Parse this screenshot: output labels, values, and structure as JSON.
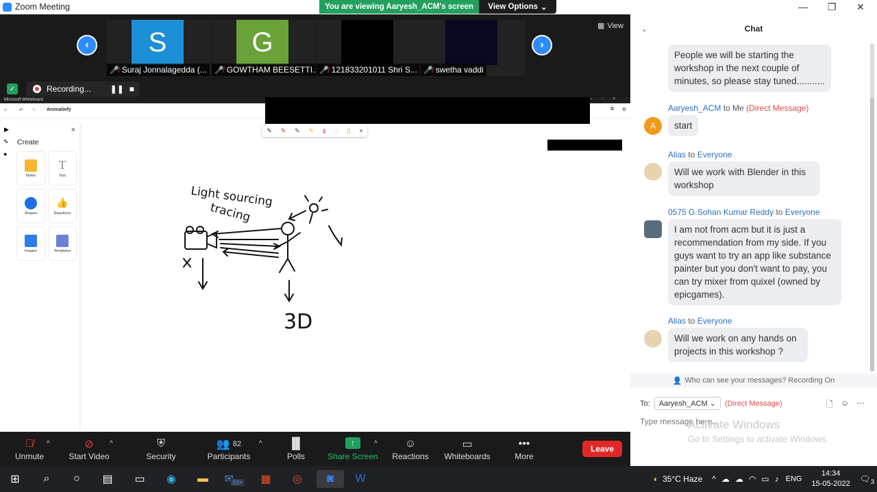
{
  "window": {
    "title": "Zoom Meeting",
    "banner": "You are viewing Aaryesh_ACM's screen",
    "view_options": "View Options",
    "view_button": "View"
  },
  "participants": [
    {
      "name": "Suraj Jonnalagedda (...",
      "initial": "S",
      "color": "#1d8fd6"
    },
    {
      "name": "GOWTHAM BEESETTI...",
      "initial": "G",
      "color": "#6aa23a"
    },
    {
      "name": "121833201011 Shri S...",
      "initial": "",
      "color": "#000000"
    },
    {
      "name": "swetha vaddi",
      "initial": "",
      "color": "#080820"
    }
  ],
  "recording": {
    "label": "Recording..."
  },
  "whiteboard": {
    "app_title": "Microsoft Whiteboard",
    "board_name": "Animatiefy",
    "panel_title": "Create",
    "items": [
      {
        "label": "Notes",
        "icon": "notes-icon"
      },
      {
        "label": "Text",
        "icon": "text-icon"
      },
      {
        "label": "Shapes",
        "icon": "shapes-icon"
      },
      {
        "label": "Reactions",
        "icon": "reactions-icon"
      },
      {
        "label": "Images",
        "icon": "images-icon"
      },
      {
        "label": "Templates",
        "icon": "templates-icon"
      }
    ],
    "drawing_text": {
      "line1": "Light sourcing",
      "line2": "tracing",
      "mark": "X",
      "label3d": "3D"
    }
  },
  "toolbar": {
    "unmute": "Unmute",
    "start_video": "Start Video",
    "security": "Security",
    "participants": "Participants",
    "participant_count": "82",
    "polls": "Polls",
    "share_screen": "Share Screen",
    "reactions": "Reactions",
    "whiteboards": "Whiteboards",
    "more": "More",
    "leave": "Leave"
  },
  "chat": {
    "title": "Chat",
    "messages": [
      {
        "sender": "",
        "text": "People we will be starting the workshop in the next couple of minutes, so please stay tuned..........."
      },
      {
        "sender": "Aaryesh_ACM",
        "to": "to Me",
        "tag": "(Direct Message)",
        "avatar": "A",
        "text": "start"
      },
      {
        "sender": "Alias",
        "to": "to",
        "recipient": "Everyone",
        "text": "Will we work with Blender in this workshop"
      },
      {
        "sender": "0575 G.Sohan Kumar Reddy",
        "to": "to",
        "recipient": "Everyone",
        "text": "I am not from acm but it is just a recommendation from my side. If you guys want to try an app like substance painter but you don't want to pay, you can try mixer from quixel (owned by epicgames)."
      },
      {
        "sender": "Alias",
        "to": "to",
        "recipient": "Everyone",
        "text": "Will we work on any hands on projects in this workshop ?"
      }
    ],
    "privacy_note": "Who can see your messages? Recording On",
    "to_label": "To:",
    "to_value": "Aaryesh_ACM",
    "to_tag": "(Direct Message)",
    "input_placeholder": "Type message here...",
    "watermark1": "Activate Windows",
    "watermark2": "Go to Settings to activate Windows."
  },
  "taskbar": {
    "weather": "35°C  Haze",
    "lang": "ENG",
    "time": "14:34",
    "date": "15-05-2022",
    "mail_badge": "99+",
    "notif_count": "3"
  }
}
